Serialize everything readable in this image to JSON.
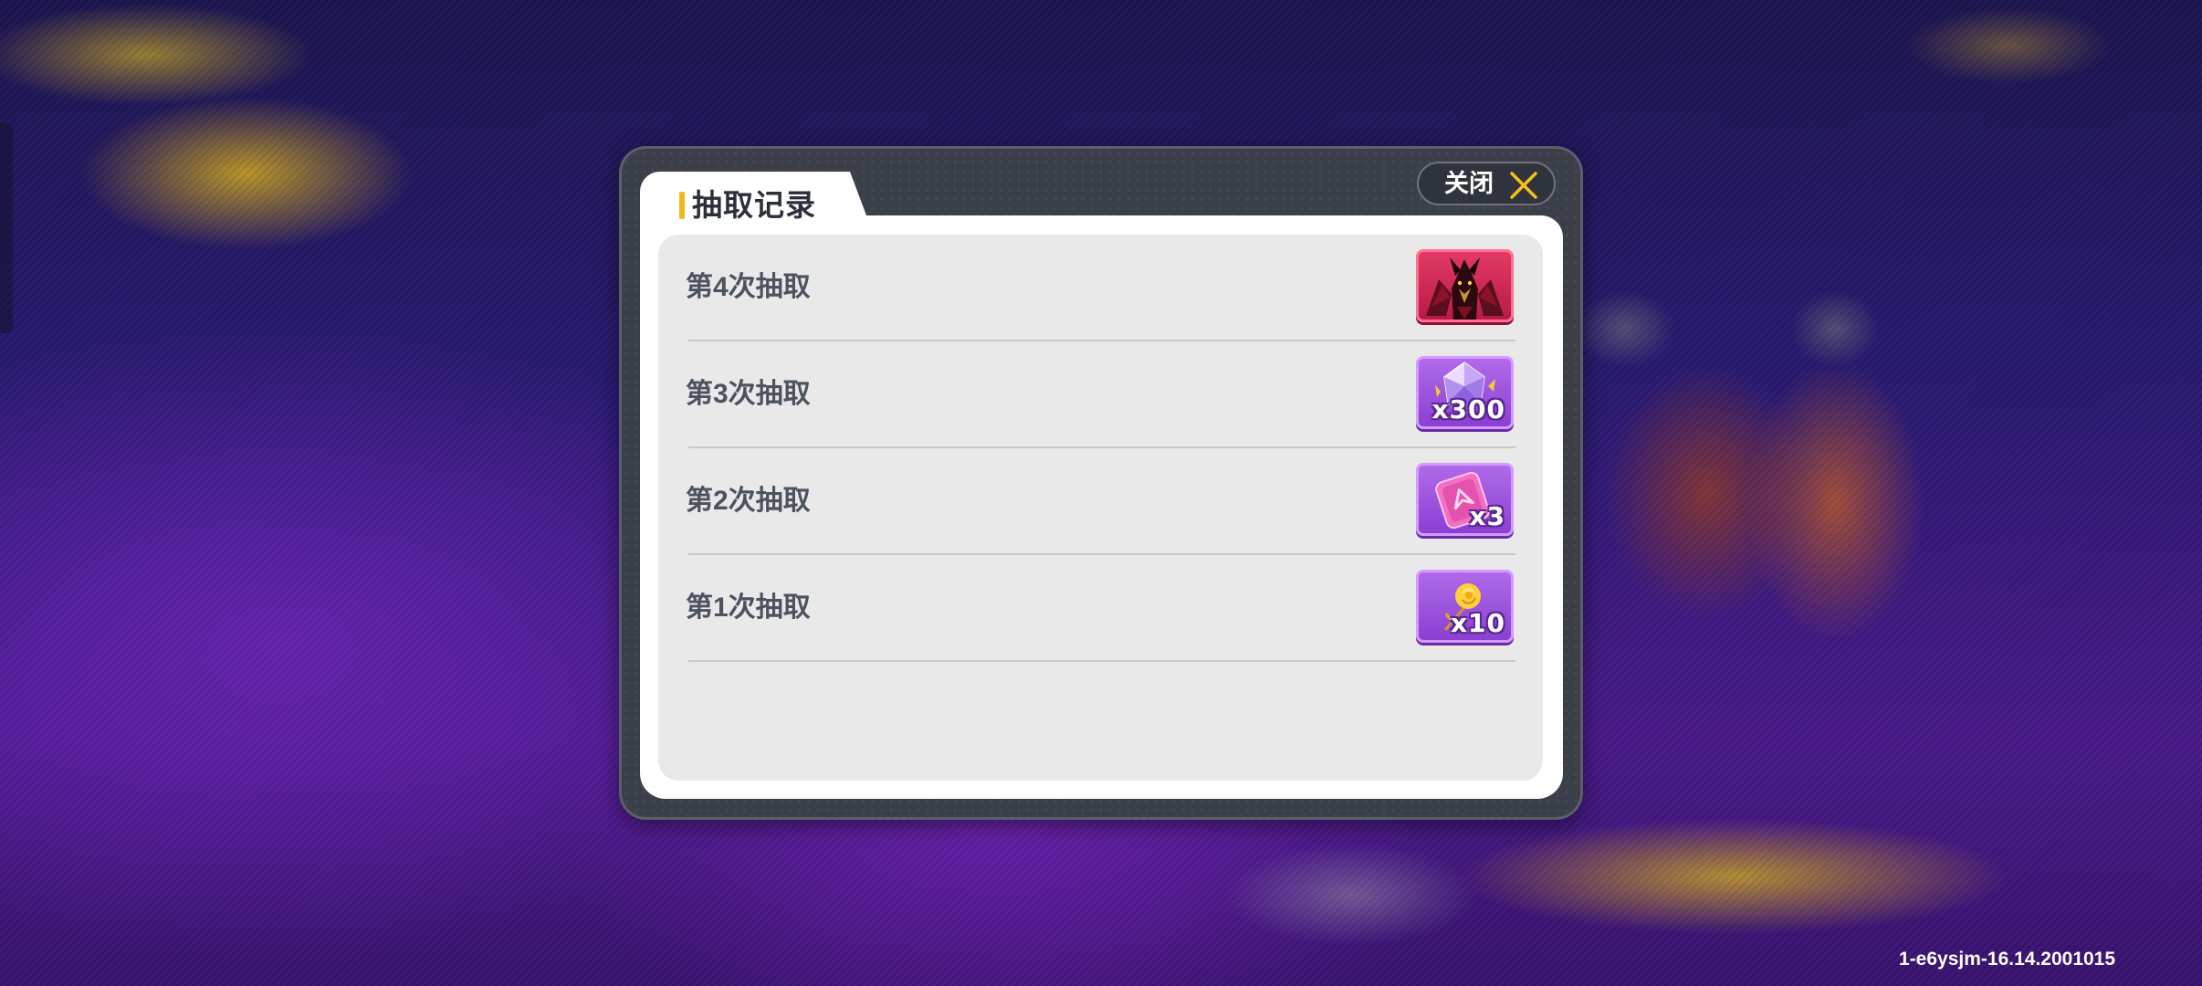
{
  "dialog": {
    "title": "抽取记录",
    "close_label": "关闭"
  },
  "records": [
    {
      "label": "第4次抽取",
      "item_icon": "demon-dragon-character-icon",
      "quantity": "",
      "rarity_color": "#d8285a"
    },
    {
      "label": "第3次抽取",
      "item_icon": "purple-crystal-icon",
      "quantity": "x300",
      "rarity_color": "#9a4fe0"
    },
    {
      "label": "第2次抽取",
      "item_icon": "pink-ticket-card-icon",
      "quantity": "x3",
      "rarity_color": "#9a4fe0"
    },
    {
      "label": "第1次抽取",
      "item_icon": "golden-rose-icon",
      "quantity": "x10",
      "rarity_color": "#9a4fe0"
    }
  ],
  "version_text": "1-e6ysjm-16.14.2001015",
  "colors": {
    "accent": "#f2b81b",
    "panel": "#e8e9e8",
    "frame": "#3b3f49"
  }
}
